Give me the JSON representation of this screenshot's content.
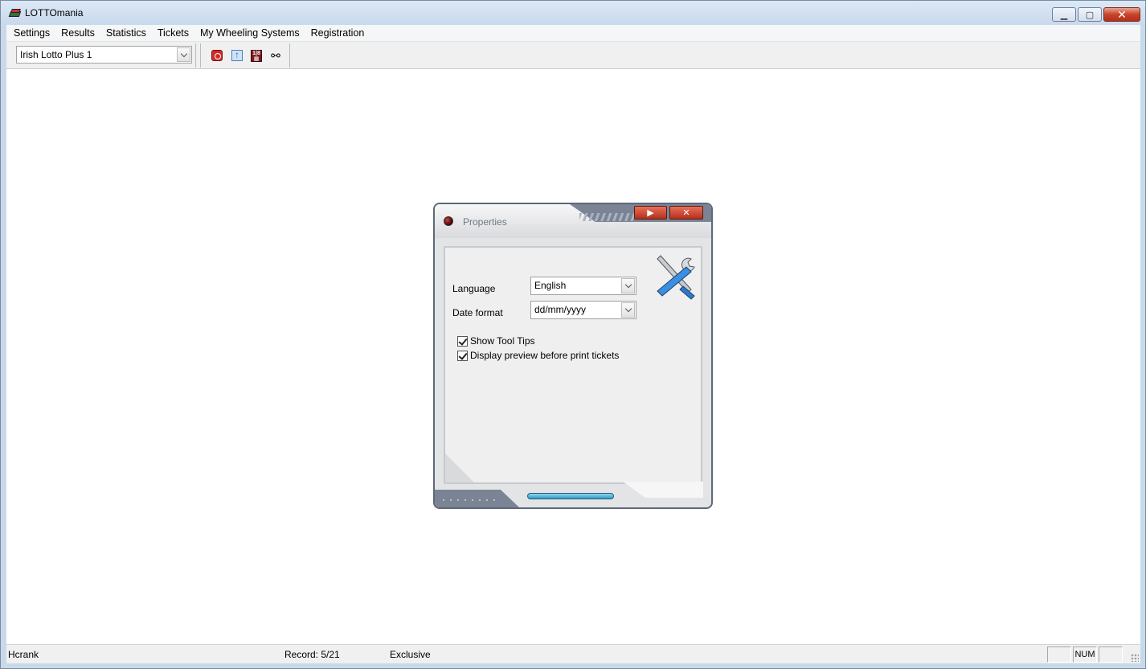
{
  "window": {
    "title": "LOTTOmania"
  },
  "menu": [
    "Settings",
    "Results",
    "Statistics",
    "Tickets",
    "My Wheeling Systems",
    "Registration"
  ],
  "toolbar": {
    "game_select": "Irish Lotto Plus 1",
    "icons": [
      "power-icon",
      "import-icon",
      "calculator-icon",
      "binoculars-icon"
    ]
  },
  "status": {
    "user": "Hcrank",
    "record": "Record: 5/21",
    "mode": "Exclusive",
    "num": "NUM"
  },
  "dialog": {
    "title": "Properties",
    "language_label": "Language",
    "language_value": "English",
    "date_label": "Date format",
    "date_value": "dd/mm/yyyy",
    "tooltips_label": "Show Tool Tips",
    "tooltips_checked": true,
    "preview_label": "Display preview before print tickets",
    "preview_checked": true
  },
  "colors": {
    "accent_red": "#c7432a",
    "dialog_dark": "#7a8494",
    "progress_blue": "#2f9bc4"
  }
}
